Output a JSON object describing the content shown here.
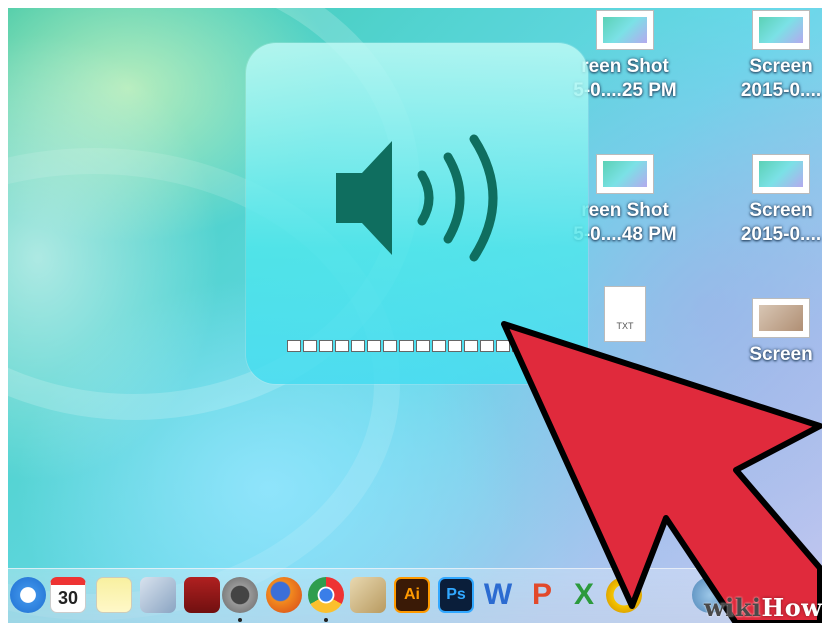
{
  "desktop_icons": [
    {
      "label_line1": "reen Shot",
      "label_line2": "5-0....25 PM",
      "kind": "screenshot"
    },
    {
      "label_line1": "Screen",
      "label_line2": "2015-0....",
      "kind": "screenshot"
    },
    {
      "label_line1": "reen Shot",
      "label_line2": "5-0....48 PM",
      "kind": "screenshot"
    },
    {
      "label_line1": "Screen",
      "label_line2": "2015-0....",
      "kind": "screenshot"
    },
    {
      "label_line1": "",
      "label_line2": "",
      "kind": "text-document",
      "badge": "TXT"
    },
    {
      "label_line1": "Screen",
      "label_line2": "",
      "kind": "photo"
    }
  ],
  "volume_hud": {
    "icon": "speaker-volume-icon",
    "level_segments": 16,
    "filled_segments": 16,
    "level": 1.0
  },
  "dock": {
    "calendar_day": "30",
    "illustrator_label": "Ai",
    "photoshop_label": "Ps",
    "word_label": "W",
    "powerpoint_label": "P",
    "excel_label": "X",
    "apps": [
      "safari-icon",
      "calendar-icon",
      "notes-icon",
      "preview-icon",
      "photo-booth-icon",
      "system-preferences-icon",
      "firefox-icon",
      "chrome-icon",
      "archive-utility-icon",
      "illustrator-icon",
      "photoshop-icon",
      "word-icon",
      "powerpoint-icon",
      "excel-icon",
      "outlook-icon",
      "downloads-icon",
      "network-icon",
      "finder-icon"
    ]
  },
  "watermark": {
    "wiki": "wiki",
    "how": "How"
  },
  "colors": {
    "arrow": "#e02a3c",
    "hud": "#5fe3e6",
    "speaker": "#0f6e5f"
  }
}
